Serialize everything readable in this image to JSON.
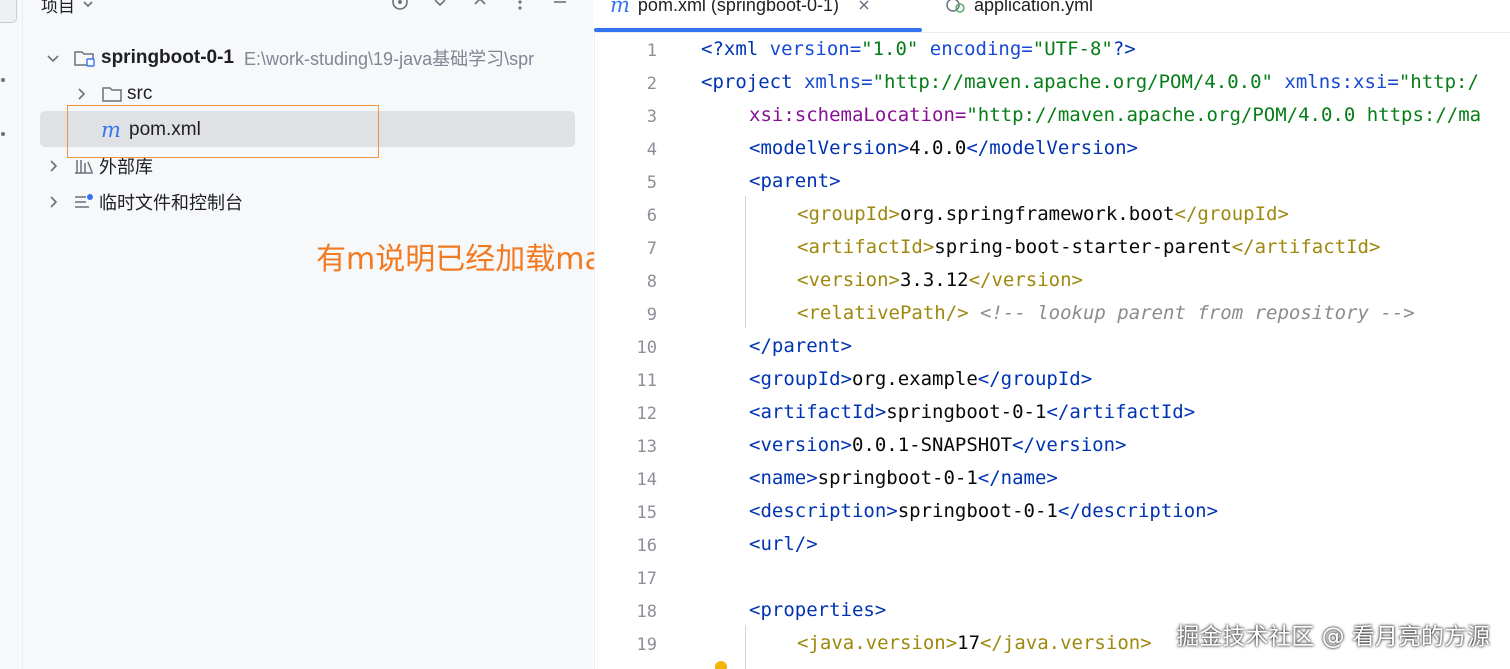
{
  "project_panel": {
    "title": "项目",
    "tree": {
      "root": {
        "name": "springboot-0-1",
        "path": "E:\\work-studing\\19-java基础学习\\spr"
      },
      "items": [
        {
          "label": "src"
        },
        {
          "label": "pom.xml",
          "badge": "m"
        },
        {
          "label": "外部库"
        },
        {
          "label": "临时文件和控制台"
        }
      ]
    },
    "annotation": "有m说明已经加载maven项目"
  },
  "tabs": [
    {
      "badge": "m",
      "label": "pom.xml (springboot-0-1)",
      "active": true
    },
    {
      "label": "application.yml",
      "active": false
    }
  ],
  "editor": {
    "line_numbers": [
      "1",
      "2",
      "3",
      "4",
      "5",
      "6",
      "7",
      "8",
      "9",
      "10",
      "11",
      "12",
      "13",
      "14",
      "15",
      "16",
      "17",
      "18",
      "19"
    ],
    "l1": {
      "a": "<?xml ",
      "b": "version=",
      "c": "\"1.0\"",
      "d": " encoding=",
      "e": "\"UTF-8\"",
      "f": "?>"
    },
    "l2": {
      "a": "<project ",
      "b": "xmlns=",
      "c": "\"http://maven.apache.org/POM/4.0.0\"",
      "d": " xmlns:xsi=",
      "e": "\"http:/"
    },
    "l3": {
      "a": "xsi:schemaLocation=",
      "b": "\"http://maven.apache.org/POM/4.0.0 https://ma"
    },
    "l4": {
      "a": "<modelVersion>",
      "b": "4.0.0",
      "c": "</modelVersion>"
    },
    "l5": {
      "a": "<parent>"
    },
    "l6": {
      "a": "<groupId>",
      "b": "org.springframework.boot",
      "c": "</groupId>"
    },
    "l7": {
      "a": "<artifactId>",
      "b": "spring-boot-starter-parent",
      "c": "</artifactId>"
    },
    "l8": {
      "a": "<version>",
      "b": "3.3.12",
      "c": "</version>"
    },
    "l9": {
      "a": "<relativePath/>",
      "b": " <!-- lookup parent from repository -->"
    },
    "l10": {
      "a": "</parent>"
    },
    "l11": {
      "a": "<groupId>",
      "b": "org.example",
      "c": "</groupId>"
    },
    "l12": {
      "a": "<artifactId>",
      "b": "springboot-0-1",
      "c": "</artifactId>"
    },
    "l13": {
      "a": "<version>",
      "b": "0.0.1-SNAPSHOT",
      "c": "</version>"
    },
    "l14": {
      "a": "<name>",
      "b": "springboot-0-1",
      "c": "</name>"
    },
    "l15": {
      "a": "<description>",
      "b": "springboot-0-1",
      "c": "</description>"
    },
    "l16": {
      "a": "<url/>"
    },
    "l18": {
      "a": "<properties>"
    },
    "l19": {
      "a": "<java.version>",
      "b": "17",
      "c": "</java.version>"
    }
  },
  "watermark": "掘金技术社区 @ 看月亮的方源",
  "icons": [
    "folder-icon",
    "module-folder-icon",
    "maven-file-icon",
    "library-icon",
    "scratch-icon",
    "chevron-right-icon",
    "chevron-down-icon",
    "gear-icon",
    "target-icon",
    "yaml-file-icon",
    "close-icon",
    "bulb-icon"
  ],
  "colors": {
    "accent": "#3574f0",
    "annotation": "#f27a22",
    "tag": "#0033b3",
    "value": "#067d17"
  }
}
